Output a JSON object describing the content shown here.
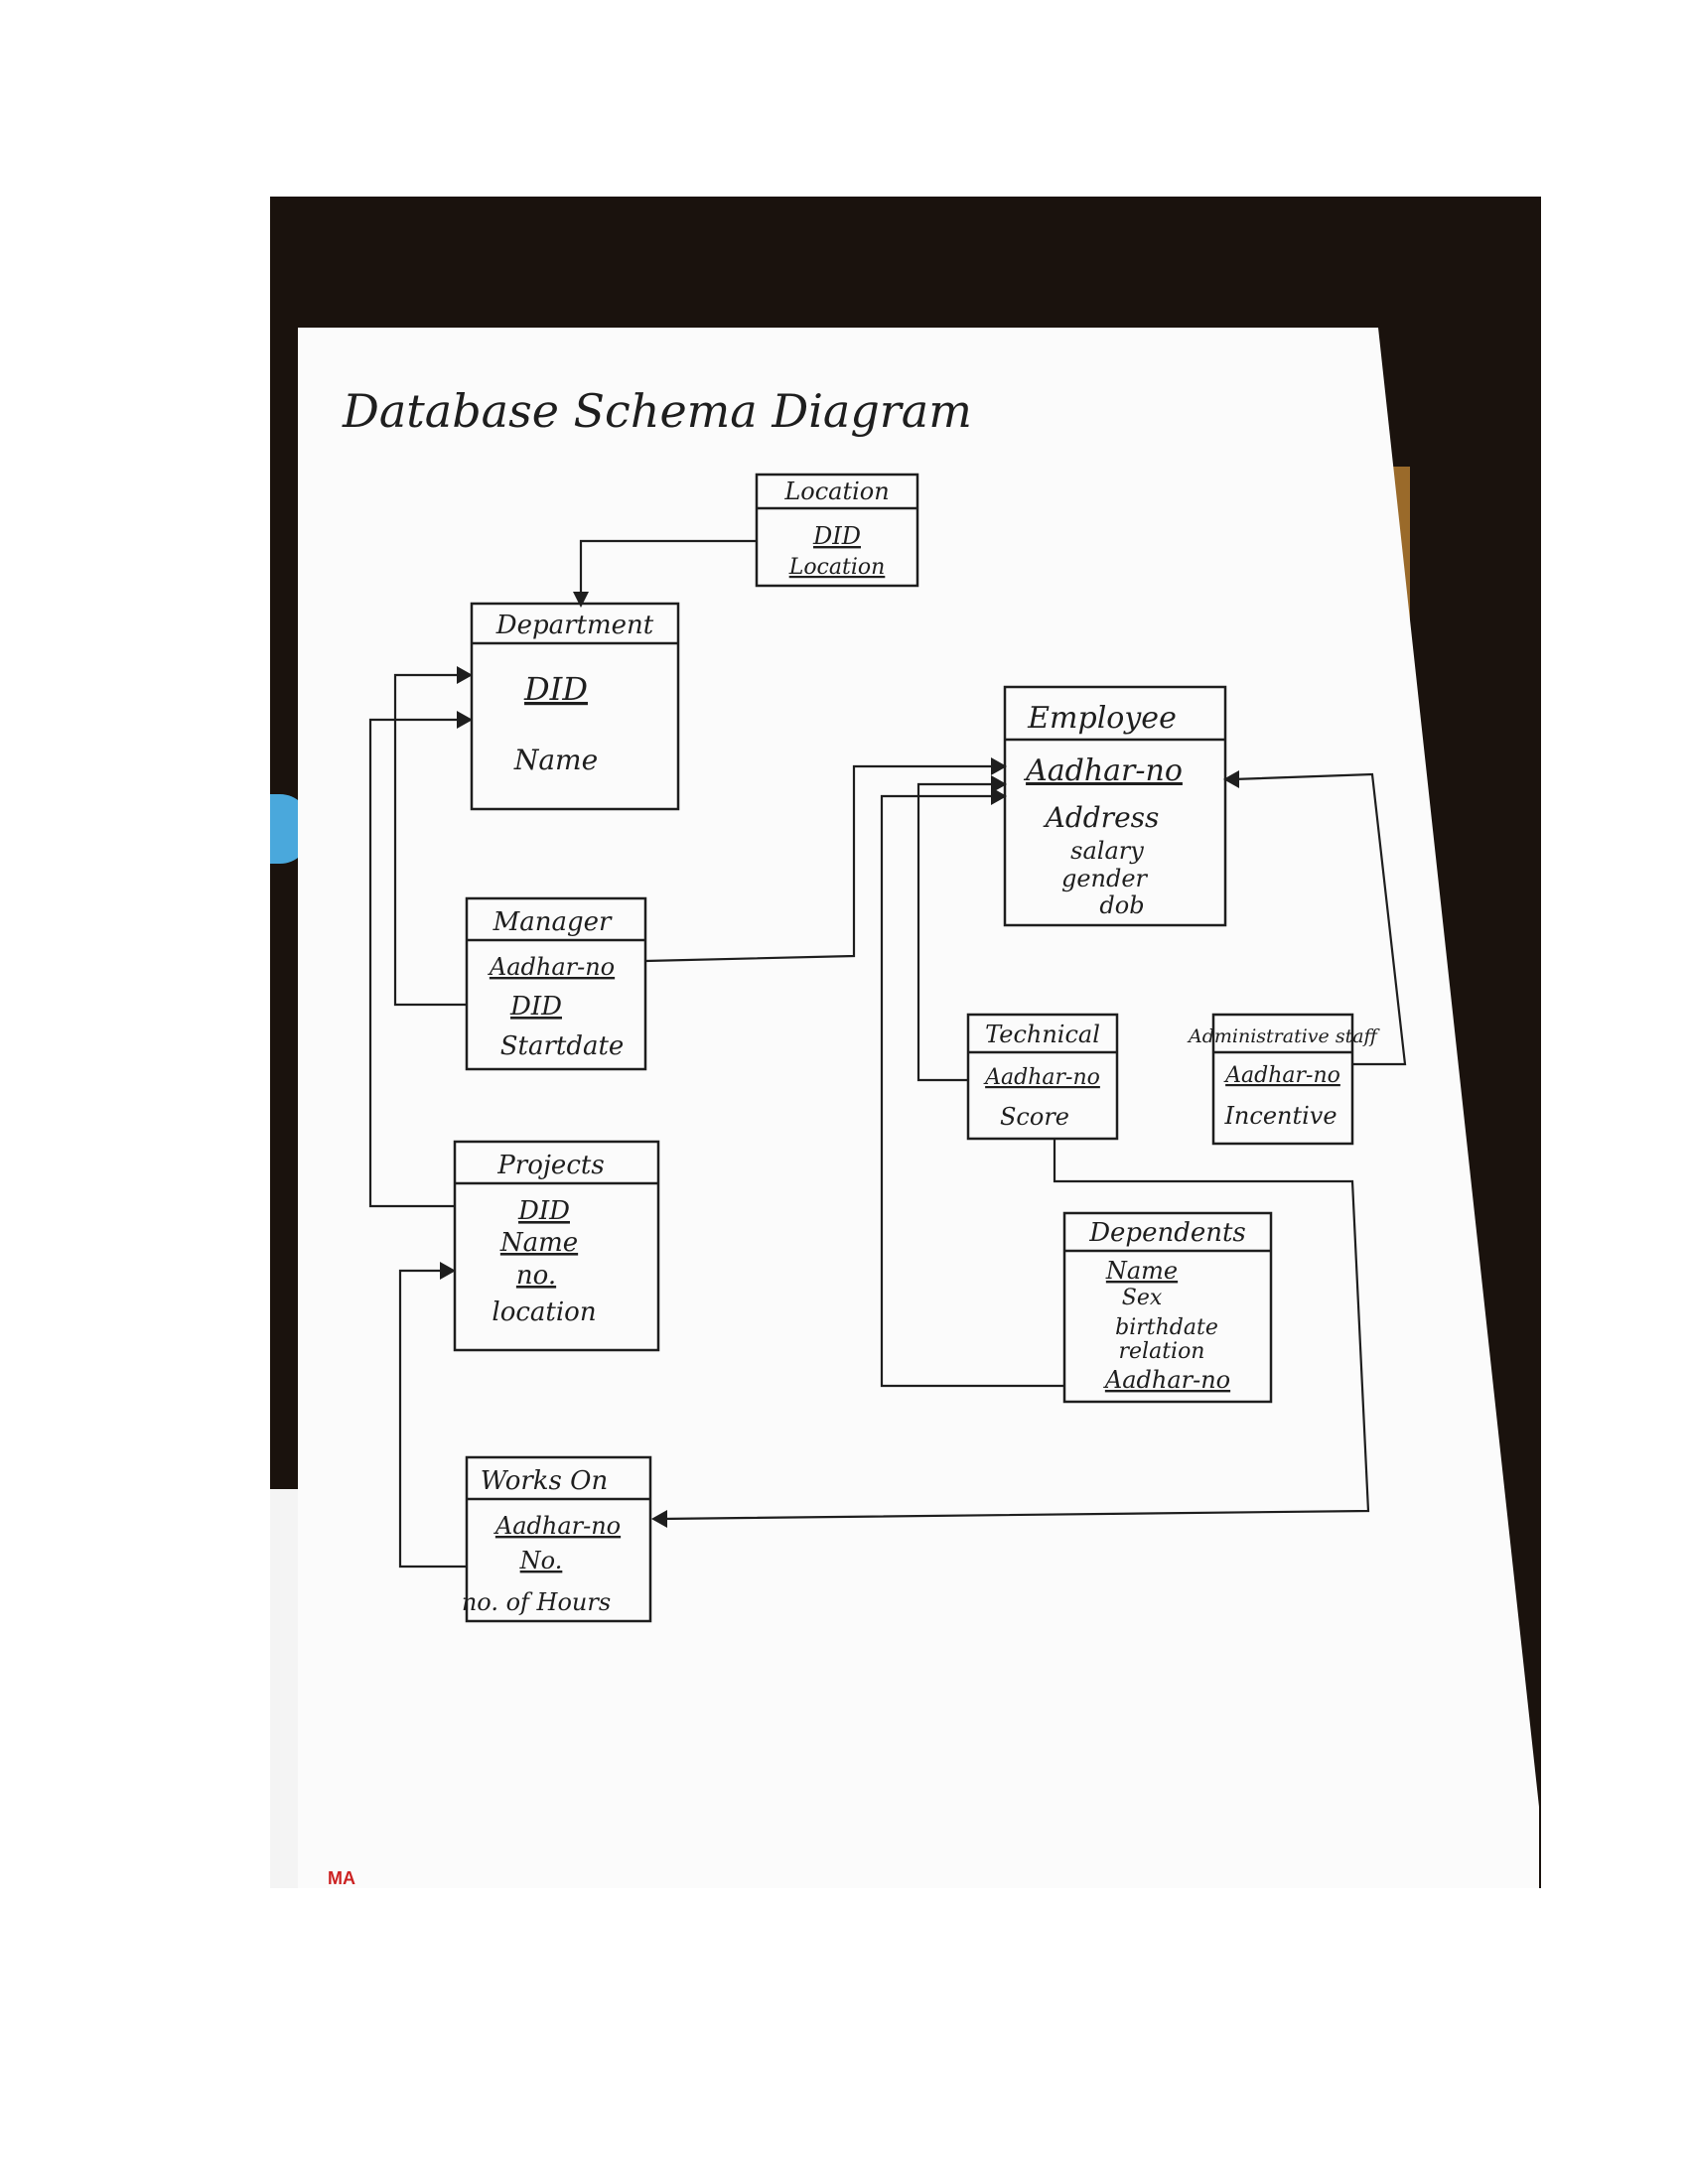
{
  "title": "Database Schema Diagram",
  "colors": {
    "ink": "#1e1e1e",
    "paper": "#fbfbfb",
    "background": "#1a120d"
  },
  "tables": {
    "location": {
      "name": "Location",
      "fields": [
        {
          "label": "DID",
          "key": true
        },
        {
          "label": "Location",
          "key": true
        }
      ]
    },
    "department": {
      "name": "Department",
      "fields": [
        {
          "label": "DID",
          "key": true
        },
        {
          "label": "Name",
          "key": false
        }
      ]
    },
    "employee": {
      "name": "Employee",
      "fields": [
        {
          "label": "Aadhar-no",
          "key": true
        },
        {
          "label": "Address",
          "key": false
        },
        {
          "label": "salary",
          "key": false
        },
        {
          "label": "gender",
          "key": false
        },
        {
          "label": "dob",
          "key": false
        }
      ]
    },
    "manager": {
      "name": "Manager",
      "fields": [
        {
          "label": "Aadhar-no",
          "key": true
        },
        {
          "label": "DID",
          "key": true
        },
        {
          "label": "Startdate",
          "key": false
        }
      ]
    },
    "technical": {
      "name": "Technical",
      "fields": [
        {
          "label": "Aadhar-no",
          "key": true
        },
        {
          "label": "Score",
          "key": false
        }
      ]
    },
    "administrative": {
      "name": "Administrative staff",
      "fields": [
        {
          "label": "Aadhar-no",
          "key": true
        },
        {
          "label": "Incentive",
          "key": false
        }
      ]
    },
    "projects": {
      "name": "Projects",
      "fields": [
        {
          "label": "DID",
          "key": true
        },
        {
          "label": "Name",
          "key": true
        },
        {
          "label": "no.",
          "key": true
        },
        {
          "label": "location",
          "key": false
        }
      ]
    },
    "dependents": {
      "name": "Dependents",
      "fields": [
        {
          "label": "Name",
          "key": true
        },
        {
          "label": "Sex",
          "key": false
        },
        {
          "label": "birthdate",
          "key": false
        },
        {
          "label": "relation",
          "key": false
        },
        {
          "label": "Aadhar-no",
          "key": true
        }
      ]
    },
    "works_on": {
      "name": "Works On",
      "fields": [
        {
          "label": "Aadhar-no",
          "key": true
        },
        {
          "label": "No.",
          "key": true
        },
        {
          "label": "no. of Hours",
          "key": false
        }
      ]
    }
  },
  "page_mark": "MA"
}
